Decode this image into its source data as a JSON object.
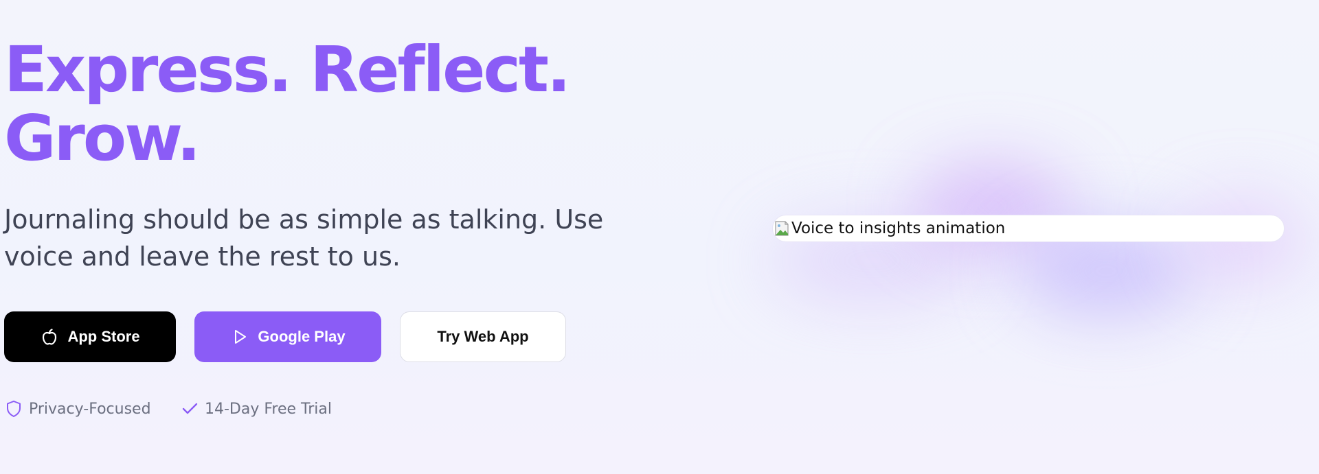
{
  "hero": {
    "headline_line1": "Express. Reflect.",
    "headline_line2": "Grow.",
    "subtitle": "Journaling should be as simple as talking. Use voice and leave the rest to us.",
    "buttons": {
      "app_store": {
        "label": "App Store",
        "icon": "apple-icon"
      },
      "google_play": {
        "label": "Google Play",
        "icon": "play-icon"
      },
      "web_app": {
        "label": "Try Web App"
      }
    },
    "badges": [
      {
        "label": "Privacy-Focused",
        "icon": "shield-icon"
      },
      {
        "label": "14-Day Free Trial",
        "icon": "check-icon"
      }
    ]
  },
  "media": {
    "alt_text": "Voice to insights animation",
    "icon": "broken-image-icon"
  },
  "colors": {
    "accent": "#8b5cf6",
    "background": "#f2f3fc",
    "app_store_button": "#000000",
    "body_text": "#3f4354",
    "muted_text": "#6b6f80"
  }
}
